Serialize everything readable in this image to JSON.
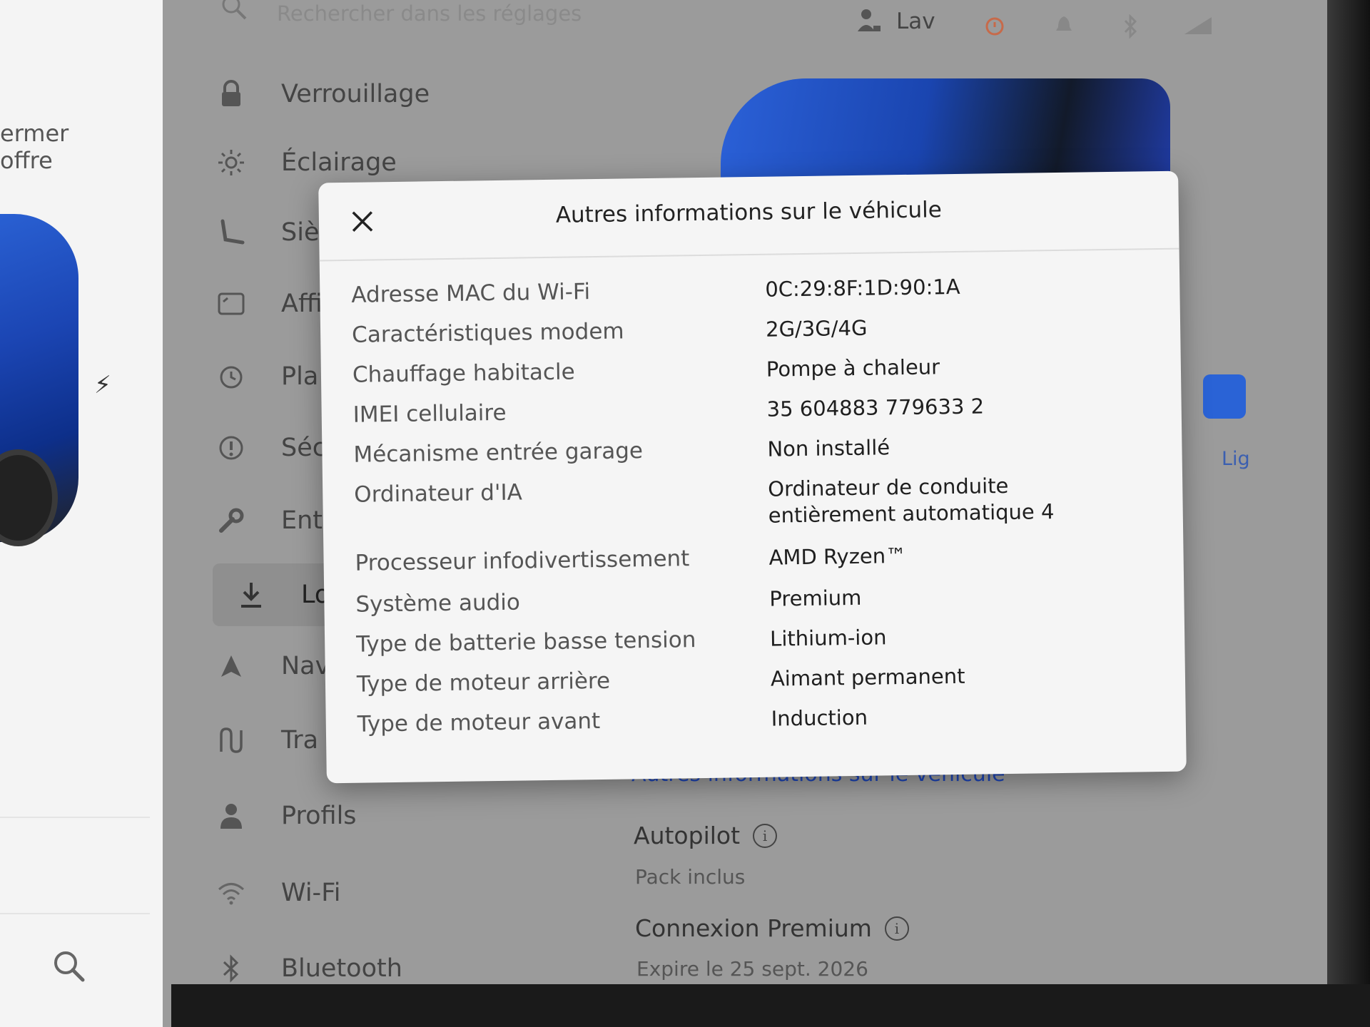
{
  "top_bar": {
    "search_placeholder": "Rechercher dans les réglages",
    "profile_name": "Lav"
  },
  "left_panel": {
    "label_line1": "ermer",
    "label_line2": "offre"
  },
  "menu": {
    "items": [
      {
        "label": "Verrouillage",
        "icon": "lock-icon"
      },
      {
        "label": "Éclairage",
        "icon": "sun-icon"
      },
      {
        "label": "Siè",
        "icon": "seat-icon"
      },
      {
        "label": "Affi",
        "icon": "display-icon"
      },
      {
        "label": "Pla",
        "icon": "schedule-icon"
      },
      {
        "label": "Séc",
        "icon": "safety-icon"
      },
      {
        "label": "Ent",
        "icon": "wrench-icon"
      },
      {
        "label": "Log",
        "icon": "download-icon"
      },
      {
        "label": "Nav",
        "icon": "navigation-icon"
      },
      {
        "label": "Tra",
        "icon": "trips-icon"
      },
      {
        "label": "Profils",
        "icon": "profile-icon"
      },
      {
        "label": "Wi-Fi",
        "icon": "wifi-icon"
      },
      {
        "label": "Bluetooth",
        "icon": "bluetooth-icon"
      }
    ]
  },
  "background": {
    "link": "Autres informations sur le véhicule",
    "autopilot_title": "Autopilot",
    "autopilot_sub": "Pack inclus",
    "connexion_title": "Connexion Premium",
    "connexion_sub": "Expire le 25 sept. 2026",
    "tile_label": "Lig"
  },
  "modal": {
    "title": "Autres informations sur le véhicule",
    "rows": [
      {
        "key": "Adresse MAC du Wi-Fi",
        "value": "0C:29:8F:1D:90:1A"
      },
      {
        "key": "Caractéristiques modem",
        "value": "2G/3G/4G"
      },
      {
        "key": "Chauffage habitacle",
        "value": "Pompe à chaleur"
      },
      {
        "key": "IMEI cellulaire",
        "value": "35 604883 779633 2"
      },
      {
        "key": "Mécanisme entrée garage",
        "value": "Non installé"
      },
      {
        "key": "Ordinateur d'IA",
        "value": "Ordinateur de conduite entièrement automatique 4"
      },
      {
        "key": "Processeur infodivertissement",
        "value": "AMD Ryzen™"
      },
      {
        "key": "Système audio",
        "value": "Premium"
      },
      {
        "key": "Type de batterie basse tension",
        "value": "Lithium-ion"
      },
      {
        "key": "Type de moteur arrière",
        "value": "Aimant permanent"
      },
      {
        "key": "Type de moteur avant",
        "value": "Induction"
      }
    ]
  },
  "colors": {
    "accent_blue": "#1f46b5",
    "car_blue": "#2b63d6",
    "modal_bg": "#f5f5f5",
    "dimmed_bg": "#9b9b9b"
  }
}
